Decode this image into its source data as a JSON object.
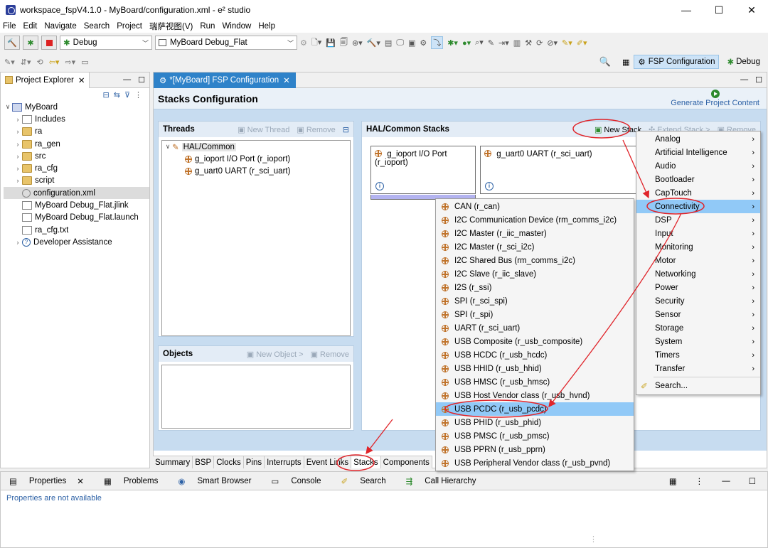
{
  "window": {
    "title": "workspace_fspV4.1.0 - MyBoard/configuration.xml - e² studio",
    "minimize": "—",
    "maximize": "☐",
    "close": "✕"
  },
  "menu": [
    "File",
    "Edit",
    "Navigate",
    "Search",
    "Project",
    "瑞萨视图(V)",
    "Run",
    "Window",
    "Help"
  ],
  "toolbar": {
    "build_mode": "Debug",
    "launch_config": "MyBoard Debug_Flat"
  },
  "perspectives": {
    "fsp": "FSP Configuration",
    "debug": "Debug"
  },
  "explorer": {
    "tab": "Project Explorer",
    "project": "MyBoard",
    "items": [
      {
        "label": "Includes",
        "icon": "includes-icon"
      },
      {
        "label": "ra",
        "icon": "folder-icon"
      },
      {
        "label": "ra_gen",
        "icon": "folder-icon"
      },
      {
        "label": "src",
        "icon": "folder-icon"
      },
      {
        "label": "ra_cfg",
        "icon": "folder-icon"
      },
      {
        "label": "script",
        "icon": "folder-icon"
      },
      {
        "label": "configuration.xml",
        "icon": "gear-icon"
      },
      {
        "label": "MyBoard Debug_Flat.jlink",
        "icon": "file-icon"
      },
      {
        "label": "MyBoard Debug_Flat.launch",
        "icon": "file-icon"
      },
      {
        "label": "ra_cfg.txt",
        "icon": "file-icon"
      },
      {
        "label": "Developer Assistance",
        "icon": "help-icon"
      }
    ]
  },
  "editor": {
    "tab": "*[MyBoard] FSP Configuration",
    "heading": "Stacks Configuration",
    "generate": "Generate Project Content",
    "threads": {
      "title": "Threads",
      "new_thread": "New Thread",
      "remove": "Remove",
      "root": "HAL/Common",
      "children": [
        "g_ioport I/O Port (r_ioport)",
        "g_uart0 UART (r_sci_uart)"
      ]
    },
    "objects": {
      "title": "Objects",
      "new_object": "New Object >",
      "remove": "Remove"
    },
    "hal": {
      "title": "HAL/Common Stacks",
      "new_stack": "New Stack",
      "extend": "Extend Stack >",
      "remove": "Remove",
      "card1": "g_ioport I/O Port (r_ioport)",
      "card2": "g_uart0 UART (r_sci_uart)"
    },
    "bottom_tabs": [
      "Summary",
      "BSP",
      "Clocks",
      "Pins",
      "Interrupts",
      "Event Links",
      "Stacks",
      "Components"
    ]
  },
  "categories": [
    "Analog",
    "Artificial Intelligence",
    "Audio",
    "Bootloader",
    "CapTouch",
    "Connectivity",
    "DSP",
    "Input",
    "Monitoring",
    "Motor",
    "Networking",
    "Power",
    "Security",
    "Sensor",
    "Storage",
    "System",
    "Timers",
    "Transfer"
  ],
  "search_item": "Search...",
  "modules": [
    "CAN (r_can)",
    "I2C Communication Device (rm_comms_i2c)",
    "I2C Master (r_iic_master)",
    "I2C Master (r_sci_i2c)",
    "I2C Shared Bus (rm_comms_i2c)",
    "I2C Slave (r_iic_slave)",
    "I2S (r_ssi)",
    "SPI (r_sci_spi)",
    "SPI (r_spi)",
    "UART (r_sci_uart)",
    "USB Composite (r_usb_composite)",
    "USB HCDC (r_usb_hcdc)",
    "USB HHID (r_usb_hhid)",
    "USB HMSC (r_usb_hmsc)",
    "USB Host Vendor class (r_usb_hvnd)",
    "USB PCDC (r_usb_pcdc)",
    "USB PHID (r_usb_phid)",
    "USB PMSC (r_usb_pmsc)",
    "USB PPRN (r_usb_pprn)",
    "USB Peripheral Vendor class (r_usb_pvnd)"
  ],
  "props": {
    "tabs": [
      "Properties",
      "Problems",
      "Smart Browser",
      "Console",
      "Search",
      "Call Hierarchy"
    ],
    "message": "Properties are not available"
  },
  "colors": {
    "selection": "#91c9f7",
    "accent": "#2e82c9",
    "annotation": "#e0242a"
  }
}
